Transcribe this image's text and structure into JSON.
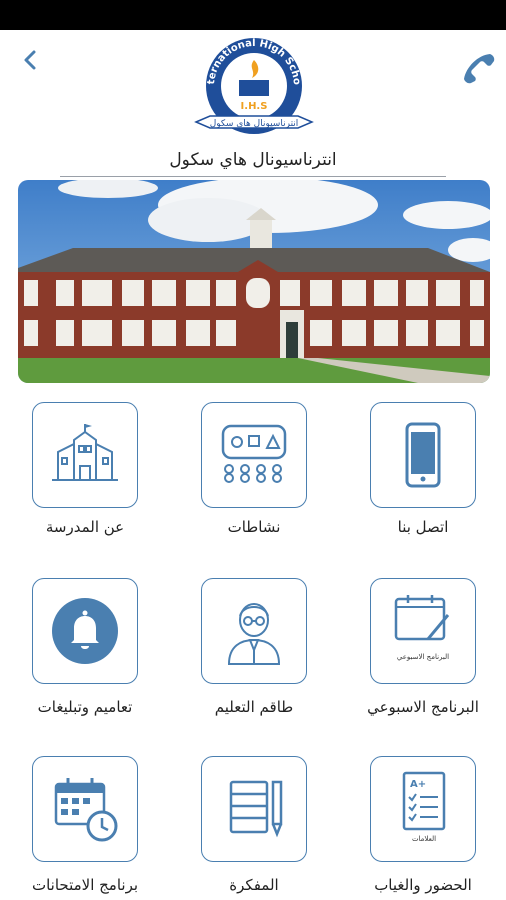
{
  "header": {
    "school_name": "انترناسيونال هاي سكول",
    "back_icon": "chevron-left-icon",
    "phone_icon": "phone-icon"
  },
  "logo": {
    "top_text": "International High School",
    "initials": "I.H.S",
    "ribbon_text": "انترناسيونال هاي سكول"
  },
  "colors": {
    "accent": "#4a7fb0",
    "logo_blue": "#1f4e9a",
    "flame": "#f0a020"
  },
  "menu": [
    {
      "label": "اتصل بنا",
      "icon": "smartphone-icon"
    },
    {
      "label": "نشاطات",
      "icon": "activity-board-icon"
    },
    {
      "label": "عن المدرسة",
      "icon": "school-building-icon"
    },
    {
      "label": "البرنامج الاسبوعي",
      "icon": "weekly-schedule-icon",
      "icon_caption": "البرنامج الاسبوعي"
    },
    {
      "label": "طاقم التعليم",
      "icon": "teacher-icon"
    },
    {
      "label": "تعاميم وتبليغات",
      "icon": "bell-icon"
    },
    {
      "label": "الحضور والغياب",
      "icon": "grades-checklist-icon",
      "icon_caption": "العلامات"
    },
    {
      "label": "المفكرة",
      "icon": "notebook-icon"
    },
    {
      "label": "برنامج الامتحانات",
      "icon": "exam-calendar-icon"
    }
  ]
}
